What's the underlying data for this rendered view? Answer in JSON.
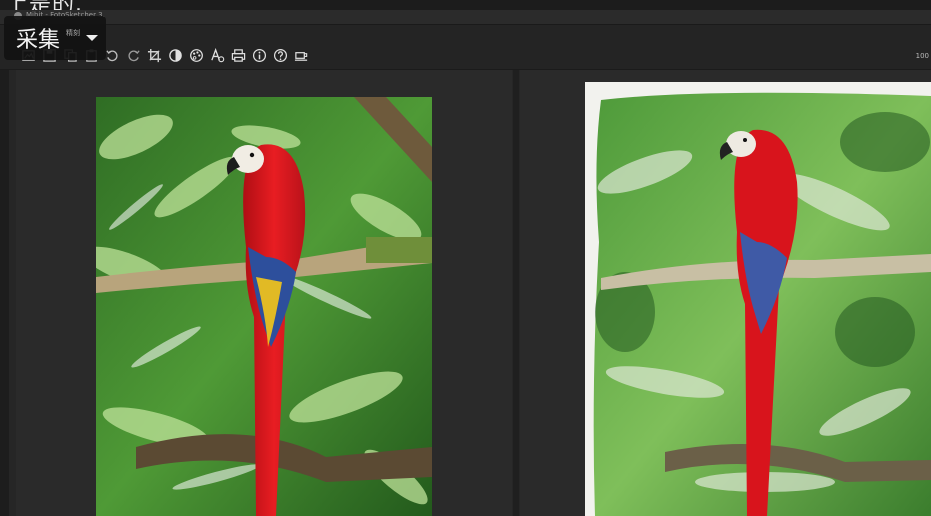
{
  "window": {
    "title": "Mibit - FotoSketcher 3.",
    "partial_heading": "上是的."
  },
  "overlay": {
    "label": "采集",
    "sub": "精刻"
  },
  "toolbar": {
    "icons": [
      "open-icon",
      "save-icon",
      "copy-icon",
      "paste-icon",
      "undo-icon",
      "redo-icon",
      "crop-icon",
      "contrast-icon",
      "palette-icon",
      "text-icon",
      "print-icon",
      "info-icon",
      "help-icon",
      "coffee-icon"
    ],
    "zoom": "100"
  },
  "colors": {
    "background": "#262626",
    "panel": "#2a2a2a",
    "parrot_red": "#d8141c",
    "parrot_blue": "#2d4f9c",
    "foliage": "#4f9a36"
  }
}
